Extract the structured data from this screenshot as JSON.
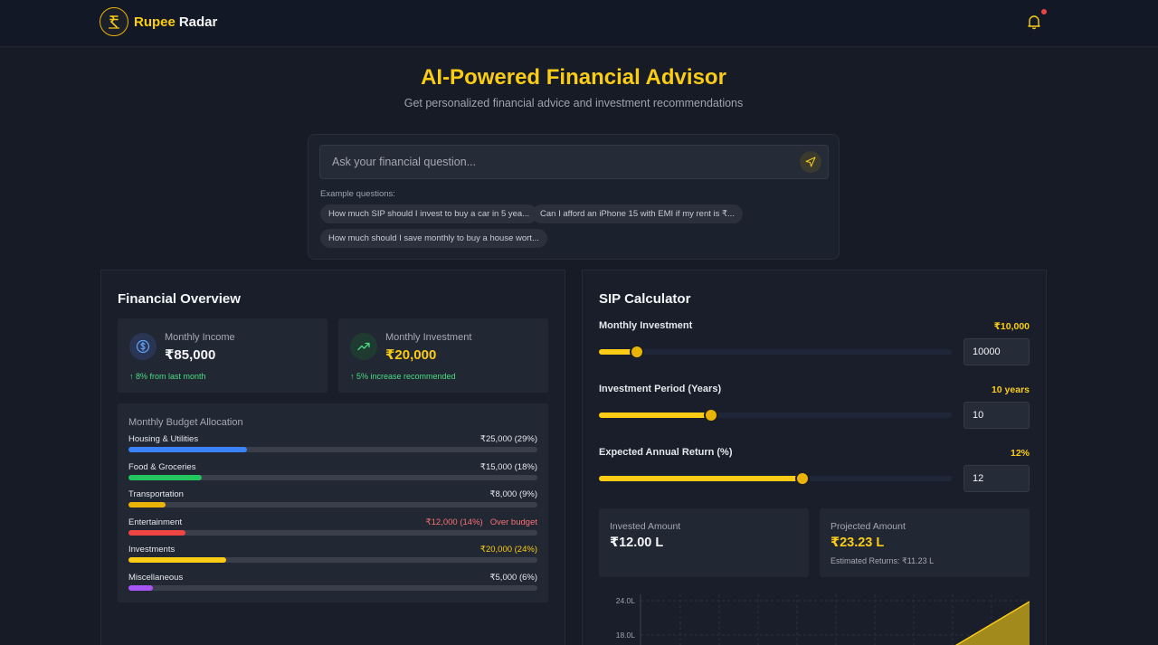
{
  "brand": {
    "name_part1": "Rupee",
    "name_part2": "Radar"
  },
  "hero": {
    "title": "AI-Powered Financial Advisor",
    "subtitle": "Get personalized financial advice and investment recommendations"
  },
  "ask": {
    "placeholder": "Ask your financial question...",
    "examples_label": "Example questions:",
    "examples": [
      "How much SIP should I invest to buy a car in 5 yea...",
      "Can I afford an iPhone 15 with EMI if my rent is ₹...",
      "How much should I save monthly to buy a house wort..."
    ]
  },
  "overview": {
    "title": "Financial Overview",
    "income": {
      "label": "Monthly Income",
      "value": "₹85,000",
      "note": "8% from last month"
    },
    "investment": {
      "label": "Monthly Investment",
      "value": "₹20,000",
      "note": "5% increase recommended"
    },
    "budget": {
      "title": "Monthly Budget Allocation",
      "items": [
        {
          "name": "Housing & Utilities",
          "value": "₹25,000 (29%)",
          "percent": 29,
          "color": "#3b82f6",
          "status": ""
        },
        {
          "name": "Food & Groceries",
          "value": "₹15,000 (18%)",
          "percent": 18,
          "color": "#22c55e",
          "status": ""
        },
        {
          "name": "Transportation",
          "value": "₹8,000 (9%)",
          "percent": 9,
          "color": "#eab308",
          "status": ""
        },
        {
          "name": "Entertainment",
          "value": "₹12,000 (14%)",
          "percent": 14,
          "color": "#ef4444",
          "status": "Over budget"
        },
        {
          "name": "Investments",
          "value": "₹20,000 (24%)",
          "percent": 24,
          "color": "#facc15",
          "status": ""
        },
        {
          "name": "Miscellaneous",
          "value": "₹5,000 (6%)",
          "percent": 6,
          "color": "#a855f7",
          "status": ""
        }
      ]
    }
  },
  "sip": {
    "title": "SIP Calculator",
    "monthly": {
      "label": "Monthly Investment",
      "display": "₹10,000",
      "input": "10000",
      "fraction": 0.108
    },
    "period": {
      "label": "Investment Period (Years)",
      "display": "10 years",
      "input": "10",
      "fraction": 0.318
    },
    "rate": {
      "label": "Expected Annual Return (%)",
      "display": "12%",
      "input": "12",
      "fraction": 0.577
    },
    "invested": {
      "label": "Invested Amount",
      "value": "₹12.00 L"
    },
    "projected": {
      "label": "Projected Amount",
      "value": "₹23.23 L",
      "note": "Estimated Returns: ₹11.23 L"
    },
    "chart": {
      "tick_top": "24.0L",
      "tick_second": "18.0L"
    }
  },
  "colors": {
    "accent": "#facc15",
    "positive": "#4ade80",
    "negative": "#f87171"
  }
}
